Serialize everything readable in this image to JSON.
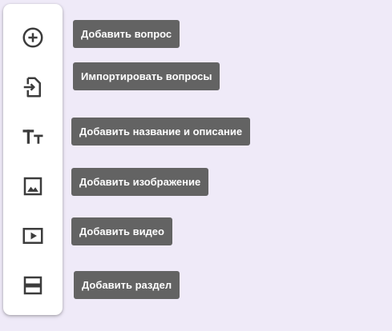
{
  "toolbar": {
    "items": [
      {
        "icon": "add-circle-icon",
        "tooltip": "Добавить вопрос"
      },
      {
        "icon": "import-icon",
        "tooltip": "Импортировать вопросы"
      },
      {
        "icon": "title-text-icon",
        "tooltip": "Добавить название и описание"
      },
      {
        "icon": "image-icon",
        "tooltip": "Добавить изображение"
      },
      {
        "icon": "video-icon",
        "tooltip": "Добавить видео"
      },
      {
        "icon": "section-icon",
        "tooltip": "Добавить раздел"
      }
    ]
  },
  "colors": {
    "background": "#efeaf8",
    "toolbar": "#ffffff",
    "icon": "#3c3c3c",
    "tooltip_bg": "#636363",
    "tooltip_text": "#ffffff"
  }
}
